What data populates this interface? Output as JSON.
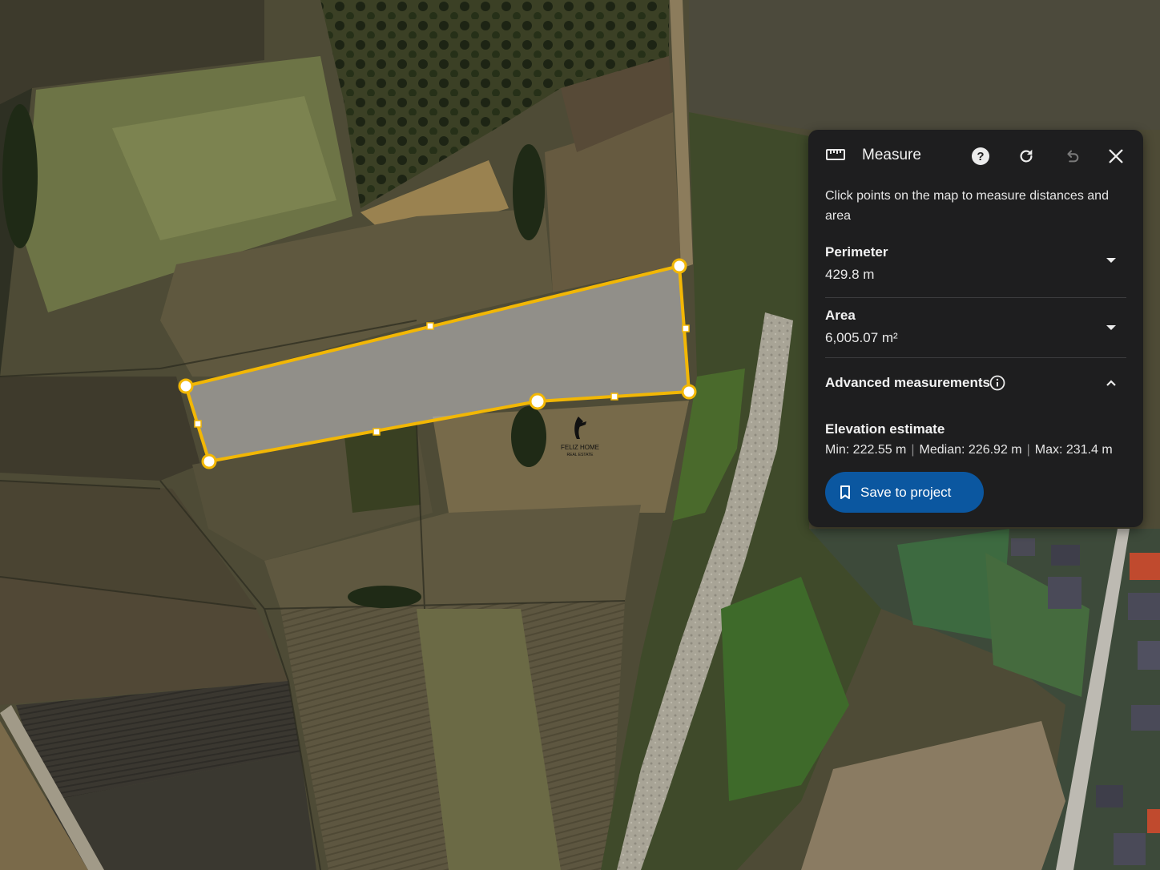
{
  "panel": {
    "title": "Measure",
    "description": "Click points on the map to measure distances and area",
    "icons": {
      "ruler": "ruler-icon",
      "help": "help-icon",
      "reset": "refresh-icon",
      "undo": "undo-icon",
      "close": "close-icon"
    },
    "perimeter": {
      "label": "Perimeter",
      "value": "429.8 m"
    },
    "area": {
      "label": "Area",
      "value": "6,005.07 m²"
    },
    "advanced": {
      "label": "Advanced measurements"
    },
    "elevation": {
      "label": "Elevation estimate",
      "min": "Min: 222.55 m",
      "median": "Median: 226.92 m",
      "max": "Max: 231.4 m",
      "separator": "|"
    },
    "save_label": "Save to project"
  },
  "watermark": {
    "name": "FELIZ HOME",
    "tagline": "REAL ESTATE"
  },
  "colors": {
    "panel_bg": "#1e1e1f",
    "accent_button": "#0b57a0",
    "outline": "#f2b705"
  }
}
